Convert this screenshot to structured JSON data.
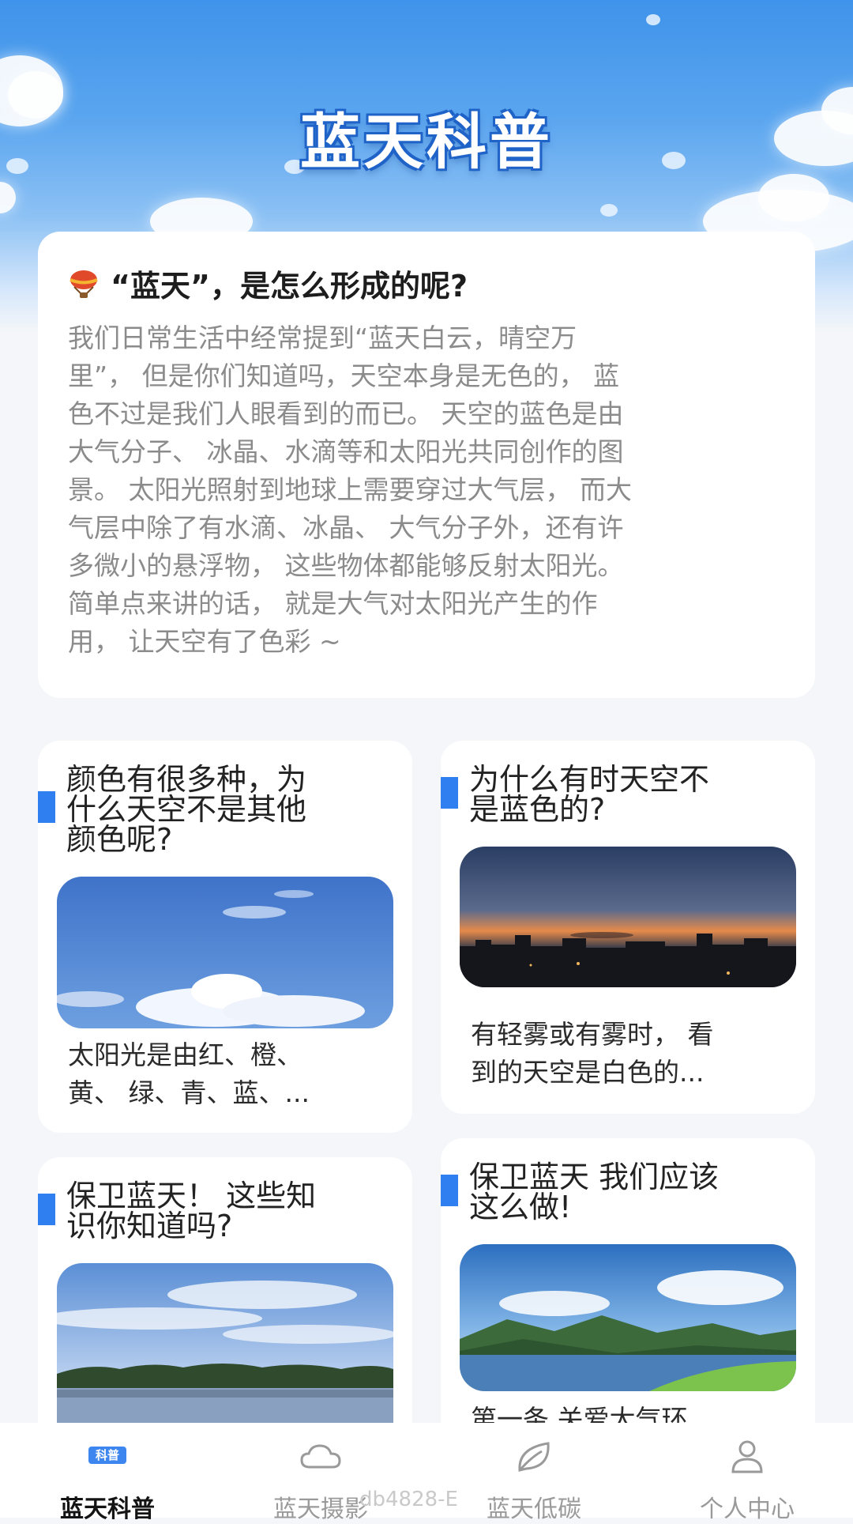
{
  "header": {
    "title": "蓝天科普"
  },
  "intro": {
    "title": "“蓝天”，是怎么形成的呢?",
    "lines": [
      "我们日常生活中经常提到“蓝天白云，晴空万",
      "里”， 但是你们知道吗，天空本身是无色的， 蓝",
      "色不过是我们人眼看到的而已。 天空的蓝色是由",
      "大气分子、 冰晶、水滴等和太阳光共同创作的图",
      "景。 太阳光照射到地球上需要穿过大气层， 而大",
      "气层中除了有水滴、冰晶、 大气分子外，还有许",
      "多微小的悬浮物， 这些物体都能够反射太阳光。",
      "简单点来讲的话， 就是大气对太阳光产生的作",
      "用， 让天空有了色彩 ~"
    ]
  },
  "cards": [
    {
      "title_lines": [
        "颜色有很多种，为",
        "什么天空不是其他",
        "颜色呢?"
      ],
      "desc_lines": [
        "太阳光是由红、橙、",
        "黄、 绿、青、蓝、..."
      ]
    },
    {
      "title_lines": [
        "为什么有时天空不",
        "是蓝色的?"
      ],
      "desc_lines": [
        "有轻雾或有雾时， 看",
        "到的天空是白色的..."
      ]
    },
    {
      "title_lines": [
        "保卫蓝天！ 这些知",
        "识你知道吗?"
      ],
      "desc_lines": []
    },
    {
      "title_lines": [
        "保卫蓝天 我们应该",
        "这么做!"
      ],
      "desc_lines": [
        "第一条 关爱大气环"
      ]
    }
  ],
  "tabbar": {
    "items": [
      {
        "label": "蓝天科普",
        "icon": "science-badge-icon",
        "badge": "科普",
        "active": true
      },
      {
        "label": "蓝天摄影",
        "icon": "cloud-icon",
        "active": false
      },
      {
        "label": "蓝天低碳",
        "icon": "leaf-icon",
        "active": false
      },
      {
        "label": "个人中心",
        "icon": "user-icon",
        "active": false
      }
    ]
  },
  "watermark": "db4828-E",
  "colors": {
    "accent": "#2f7ff0",
    "active_tab": "#141414",
    "inactive_tab": "#9a9a9a"
  }
}
